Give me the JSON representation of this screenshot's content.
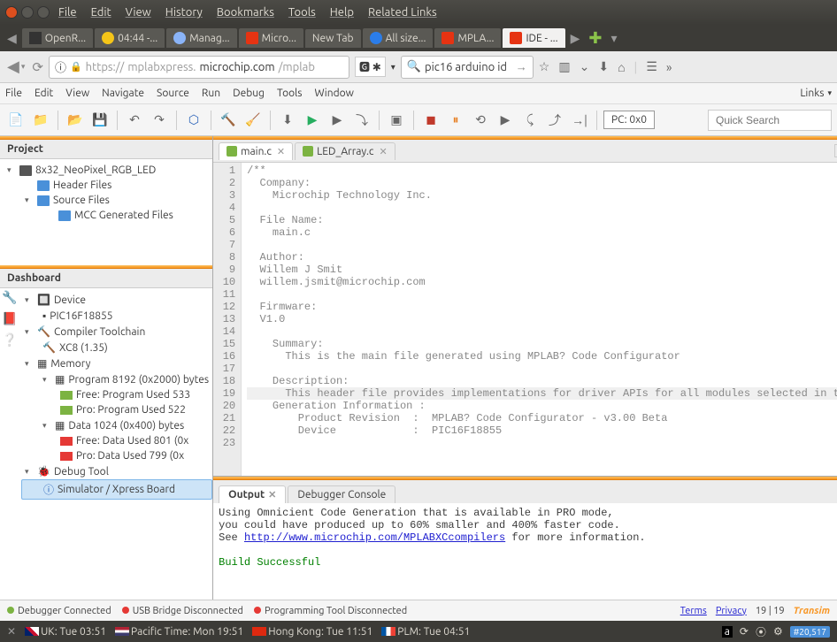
{
  "titlebar_menu": [
    "File",
    "Edit",
    "View",
    "History",
    "Bookmarks",
    "Tools",
    "Help",
    "Related Links"
  ],
  "browser_tabs": [
    {
      "label": "OpenR..."
    },
    {
      "label": "04:44 -..."
    },
    {
      "label": "Manag..."
    },
    {
      "label": "Micro..."
    },
    {
      "label": "New Tab"
    },
    {
      "label": "All size..."
    },
    {
      "label": "MPLA..."
    },
    {
      "label": "IDE - ..."
    }
  ],
  "url": {
    "scheme": "https://",
    "sub": "mplabxpress.",
    "domain": "microchip.com",
    "path": "/mplab"
  },
  "url_search": "pic16 arduino id",
  "ide_menu": [
    "File",
    "Edit",
    "View",
    "Navigate",
    "Source",
    "Run",
    "Debug",
    "Tools",
    "Window"
  ],
  "ide_links_label": "Links",
  "pc_label": "PC: 0x0",
  "quick_search_placeholder": "Quick Search",
  "panels": {
    "project_title": "Project",
    "dashboard_title": "Dashboard"
  },
  "project_tree": {
    "root": "8x32_NeoPixel_RGB_LED",
    "header_files": "Header Files",
    "source_files": "Source Files",
    "mcc_files": "MCC Generated Files"
  },
  "dashboard": {
    "device": "Device",
    "device_name": "PIC16F18855",
    "toolchain": "Compiler Toolchain",
    "toolchain_name": "XC8 (1.35)",
    "memory": "Memory",
    "program": "Program 8192 (0x2000) bytes",
    "prog_free": "Free: Program Used 533",
    "prog_pro": "Pro: Program Used 522",
    "data": "Data 1024 (0x400) bytes",
    "data_free": "Free: Data Used 801 (0x",
    "data_pro": "Pro: Data Used 799 (0x",
    "debug_tool": "Debug Tool",
    "simulator": "Simulator / Xpress Board"
  },
  "editor_tabs": [
    {
      "name": "main.c",
      "active": true
    },
    {
      "name": "LED_Array.c",
      "active": false
    }
  ],
  "code_lines": [
    "/**",
    "  Company:",
    "    Microchip Technology Inc.",
    "",
    "  File Name:",
    "    main.c",
    "",
    "  Author:",
    "  Willem J Smit",
    "  willem.jsmit@microchip.com",
    "",
    "  Firmware:",
    "  V1.0",
    "",
    "    Summary:",
    "      This is the main file generated using MPLAB? Code Configurator",
    "",
    "    Description:",
    "      This header file provides implementations for driver APIs for all modules selected in the GUI.",
    "    Generation Information :",
    "        Product Revision  :  MPLAB? Code Configurator - v3.00 Beta",
    "        Device            :  PIC16F18855",
    ""
  ],
  "output": {
    "tab_output": "Output",
    "tab_debugger": "Debugger Console",
    "line1": "Using Omnicient Code Generation that is available in PRO mode,",
    "line2": "you could have produced up to 60% smaller and 400% faster code.",
    "line3_pre": "See ",
    "line3_link": "http://www.microchip.com/MPLABXCcompilers",
    "line3_post": " for more information.",
    "build": "Build Successful"
  },
  "status": {
    "debugger": "Debugger Connected",
    "usb": "USB Bridge Disconnected",
    "prog": "Programming Tool Disconnected",
    "terms": "Terms",
    "privacy": "Privacy",
    "pos": "19 | 19",
    "brand": "Transim"
  },
  "osbar": {
    "uk": "UK: Tue 03:51",
    "pacific": "Pacific Time: Mon 19:51",
    "hk": "Hong Kong: Tue 11:51",
    "plm": "PLM: Tue 04:51",
    "count": "#20,517"
  }
}
